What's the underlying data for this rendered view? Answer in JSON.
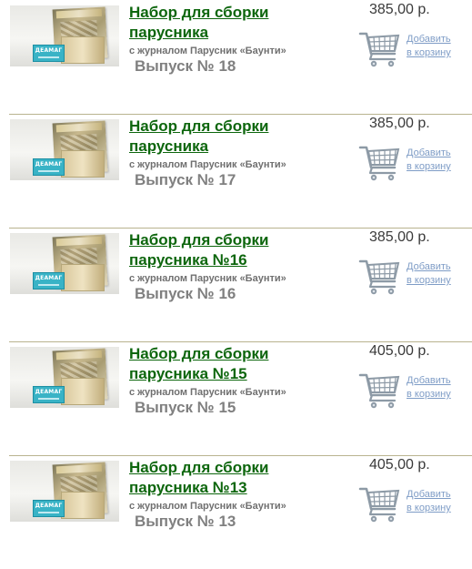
{
  "products": [
    {
      "title_lines": [
        "Набор для сборки",
        "парусника"
      ],
      "subtitle": "с журналом Парусник «Баунти»",
      "issue": "Выпуск № 18",
      "price": "385,00 р.",
      "add_to_cart": [
        "Добавить",
        "в корзину"
      ],
      "card_label": "ДЕАМАГ"
    },
    {
      "title_lines": [
        "Набор для сборки",
        "парусника"
      ],
      "subtitle": "с журналом Парусник «Баунти»",
      "issue": "Выпуск № 17",
      "price": "385,00 р.",
      "add_to_cart": [
        "Добавить",
        "в корзину"
      ],
      "card_label": "ДЕАМАГ"
    },
    {
      "title_lines": [
        "Набор для сборки",
        "парусника №16"
      ],
      "subtitle": "с журналом Парусник «Баунти»",
      "issue": "Выпуск № 16",
      "price": "385,00 р.",
      "add_to_cart": [
        "Добавить",
        "в корзину"
      ],
      "card_label": "ДЕАМАГ"
    },
    {
      "title_lines": [
        "Набор для сборки",
        "парусника №15"
      ],
      "subtitle": "с журналом Парусник «Баунти»",
      "issue": "Выпуск № 15",
      "price": "405,00 р.",
      "add_to_cart": [
        "Добавить",
        "в корзину"
      ],
      "card_label": "ДЕАМАГ"
    },
    {
      "title_lines": [
        "Набор для сборки",
        "парусника №13"
      ],
      "subtitle": "с журналом Парусник «Баунти»",
      "issue": "Выпуск № 13",
      "price": "405,00 р.",
      "add_to_cart": [
        "Добавить",
        "в корзину"
      ],
      "card_label": "ДЕАМАГ"
    }
  ],
  "icons": {
    "cart": "shopping-cart-icon"
  },
  "colors": {
    "title_link": "#0d660d",
    "add_link": "#7e9cc6",
    "divider": "#b9b38f",
    "cart": "#8d9aa6",
    "card": "#39b3c6"
  }
}
